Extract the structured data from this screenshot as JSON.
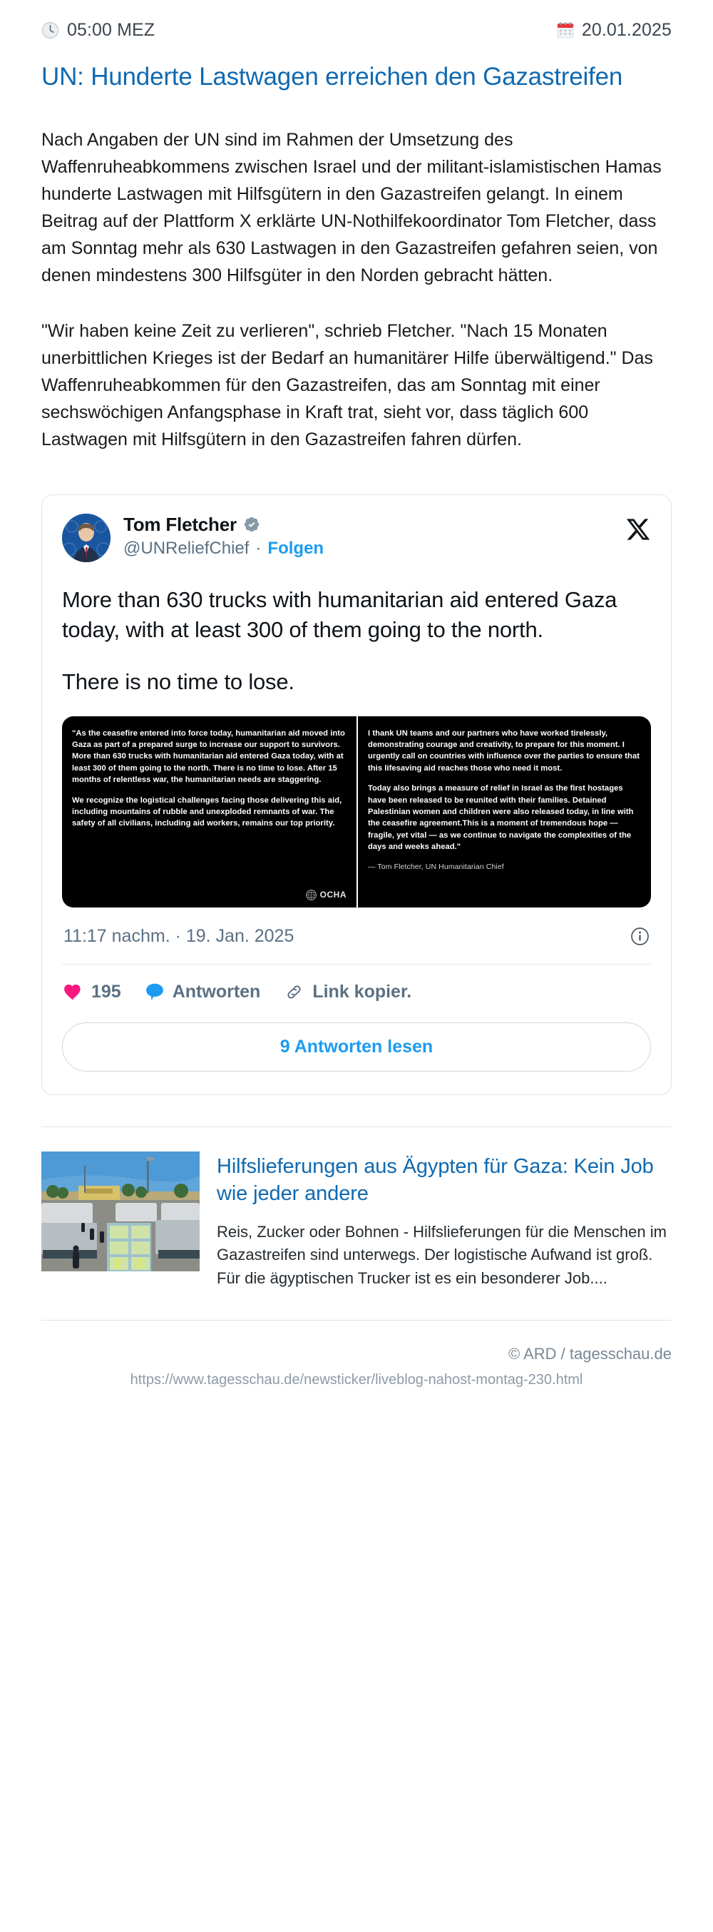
{
  "meta": {
    "time": "05:00 MEZ",
    "date": "20.01.2025",
    "clock_icon": "clock-icon",
    "calendar_icon": "calendar-icon"
  },
  "article": {
    "headline": "UN: Hunderte Lastwagen erreichen den Gazastreifen",
    "paragraphs": [
      "Nach Angaben der UN sind im Rahmen der Umsetzung des Waffenruheabkommens zwischen Israel und der militant-islamistischen Hamas hunderte Lastwagen mit Hilfsgütern in den Gazastreifen gelangt. In einem Beitrag auf der Plattform X erklärte UN-Nothilfekoordinator Tom Fletcher, dass am Sonntag mehr als 630 Lastwagen in den Gazastreifen gefahren seien, von denen mindestens 300 Hilfsgüter in den Norden gebracht hätten.",
      "\"Wir haben keine Zeit zu verlieren\", schrieb Fletcher. \"Nach 15 Monaten unerbittlichen Krieges ist der Bedarf an humanitärer Hilfe überwältigend.\" Das Waffenruheabkommen für den Gazastreifen, das am Sonntag mit einer sechswöchigen Anfangsphase in Kraft trat, sieht vor, dass täglich 600 Lastwagen mit Hilfsgütern in den Gazastreifen fahren dürfen."
    ]
  },
  "tweet": {
    "display_name": "Tom Fletcher",
    "verified_icon": "verified-badge-icon",
    "handle": "@UNReliefChief",
    "separator": "·",
    "follow_label": "Folgen",
    "platform_icon": "x-logo-icon",
    "avatar_icon": "avatar",
    "text_line_1": "More than 630 trucks with humanitarian aid entered Gaza today, with at least 300 of them going to the north.",
    "text_line_2": "There is no time to lose.",
    "media": {
      "left_paragraphs": [
        "\"As the ceasefire entered into force today, humanitarian aid moved into Gaza as part of a prepared surge to increase our support to survivors. More than 630 trucks with humanitarian aid entered Gaza today, with at least 300 of them going to the north. There is no time to lose. After 15 months of relentless war, the humanitarian needs are staggering.",
        "We recognize the logistical challenges facing those delivering this aid, including mountains of rubble and unexploded remnants of war. The safety of all civilians, including aid workers, remains our top priority."
      ],
      "right_paragraphs": [
        "I thank UN teams and our partners who have worked tirelessly, demonstrating courage and creativity, to prepare for this moment. I urgently call on countries with influence over the parties to ensure that this lifesaving aid reaches those who need it most.",
        "Today also brings a measure of relief in Israel as the first hostages have been released to be reunited with their families. Detained Palestinian women and children were also released today, in line with the ceasefire agreement.This is a moment of tremendous hope — fragile, yet vital — as we continue to navigate the complexities of the days and weeks ahead.\""
      ],
      "attribution": "— Tom Fletcher, UN Humanitarian Chief",
      "logo_text": "OCHA",
      "logo_icon": "ocha-logo-icon"
    },
    "timestamp": "11:17 nachm. · 19. Jan. 2025",
    "info_icon": "info-icon",
    "actions": {
      "like_icon": "heart-icon",
      "like_count": "195",
      "reply_icon": "speech-bubble-icon",
      "reply_label": "Antworten",
      "link_icon": "link-icon",
      "link_label": "Link kopier."
    },
    "replies_button_label": "9 Antworten lesen"
  },
  "teaser": {
    "thumb_icon": "aid-trucks-photo",
    "title": "Hilfslieferungen aus Ägypten für Gaza: Kein Job wie jeder andere",
    "text": "Reis, Zucker oder Bohnen - Hilfslieferungen für die Menschen im Gazastreifen sind unterwegs. Der logistische Aufwand ist groß. Für die ägyptischen Trucker ist es ein besonderer Job...."
  },
  "footer": {
    "copyright": "© ARD / tagesschau.de",
    "url": "https://www.tagesschau.de/newsticker/liveblog-nahost-montag-230.html"
  },
  "colors": {
    "link_blue": "#1069b0",
    "twitter_blue": "#1d9bf0",
    "like_pink": "#f91880",
    "muted": "#5b7083"
  }
}
